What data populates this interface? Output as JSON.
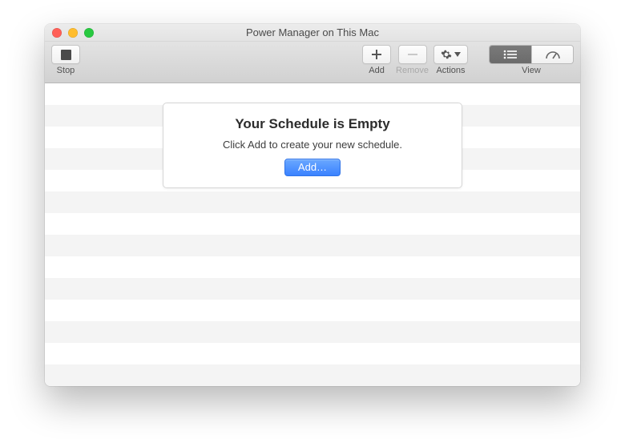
{
  "window": {
    "title": "Power Manager on This Mac"
  },
  "toolbar": {
    "stop": "Stop",
    "add": "Add",
    "remove": "Remove",
    "actions": "Actions",
    "view": "View"
  },
  "empty_state": {
    "heading": "Your Schedule is Empty",
    "message": "Click Add to create your new schedule.",
    "button": "Add…"
  }
}
